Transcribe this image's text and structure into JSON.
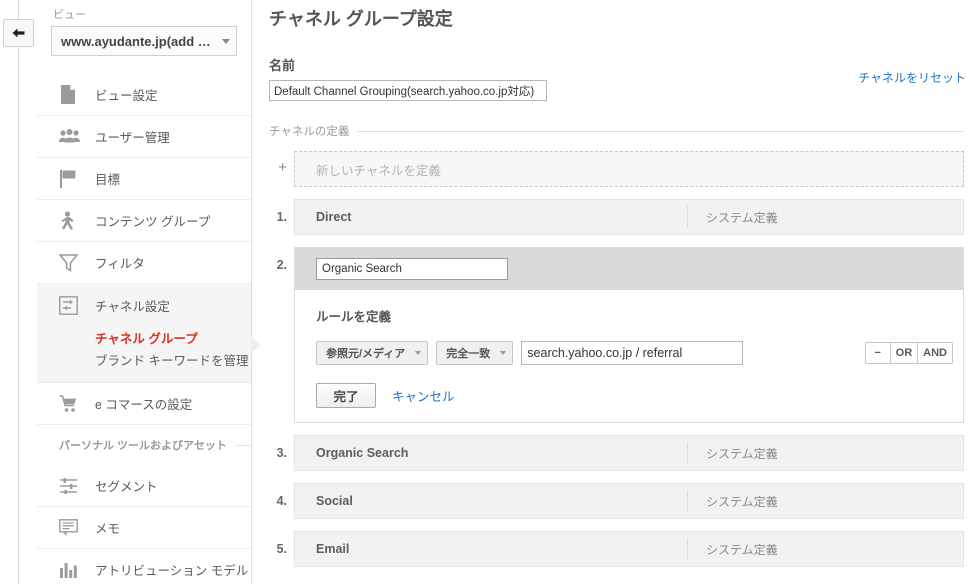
{
  "rail": {
    "back_icon": "back-arrow-icon"
  },
  "sidebar": {
    "view_label": "ビュー",
    "view_value": "www.ayudante.jp(add …",
    "items": [
      {
        "label": "ビュー設定",
        "icon": "document-icon"
      },
      {
        "label": "ユーザー管理",
        "icon": "users-icon"
      },
      {
        "label": "目標",
        "icon": "flag-icon"
      },
      {
        "label": "コンテンツ グループ",
        "icon": "person-walking-icon"
      },
      {
        "label": "フィルタ",
        "icon": "funnel-icon"
      },
      {
        "label": "チャネル設定",
        "icon": "channel-settings-icon"
      }
    ],
    "sub_items": [
      {
        "label": "チャネル グループ",
        "selected": true
      },
      {
        "label": "ブランド キーワードを管理",
        "selected": false
      }
    ],
    "ecommerce": {
      "label": "e コマースの設定",
      "icon": "cart-icon"
    },
    "section_title": "パーソナル ツールおよびアセット",
    "personal_items": [
      {
        "label": "セグメント",
        "icon": "segment-icon"
      },
      {
        "label": "メモ",
        "icon": "note-icon"
      },
      {
        "label": "アトリビューション モデル",
        "icon": "bar-chart-icon"
      }
    ],
    "accent_color": "#d93025"
  },
  "main": {
    "page_title": "チャネル グループ設定",
    "name_label": "名前",
    "name_value": "Default Channel Grouping(search.yahoo.co.jp対応)",
    "reset_link": "チャネルをリセット",
    "definitions_legend": "チャネルの定義",
    "new_channel": {
      "plus": "+",
      "placeholder": "新しいチャネルを定義"
    },
    "system_tag": "システム定義",
    "channels": [
      {
        "num": "1.",
        "name": "Direct",
        "tag": "システム定義",
        "editing": false
      },
      {
        "num": "2.",
        "name": "Organic Search",
        "editing": true
      },
      {
        "num": "3.",
        "name": "Organic Search",
        "tag": "システム定義",
        "editing": false
      },
      {
        "num": "4.",
        "name": "Social",
        "tag": "システム定義",
        "editing": false
      },
      {
        "num": "5.",
        "name": "Email",
        "tag": "システム定義",
        "editing": false
      }
    ],
    "editor": {
      "name_value": "Organic Search",
      "rule_title": "ルールを定義",
      "dimension": "参照元/メディア",
      "match_type": "完全一致",
      "value": "search.yahoo.co.jp / referral",
      "minus_label": "−",
      "or_label": "OR",
      "and_label": "AND",
      "done_label": "完了",
      "cancel_label": "キャンセル"
    },
    "link_color": "#1a73c8"
  }
}
